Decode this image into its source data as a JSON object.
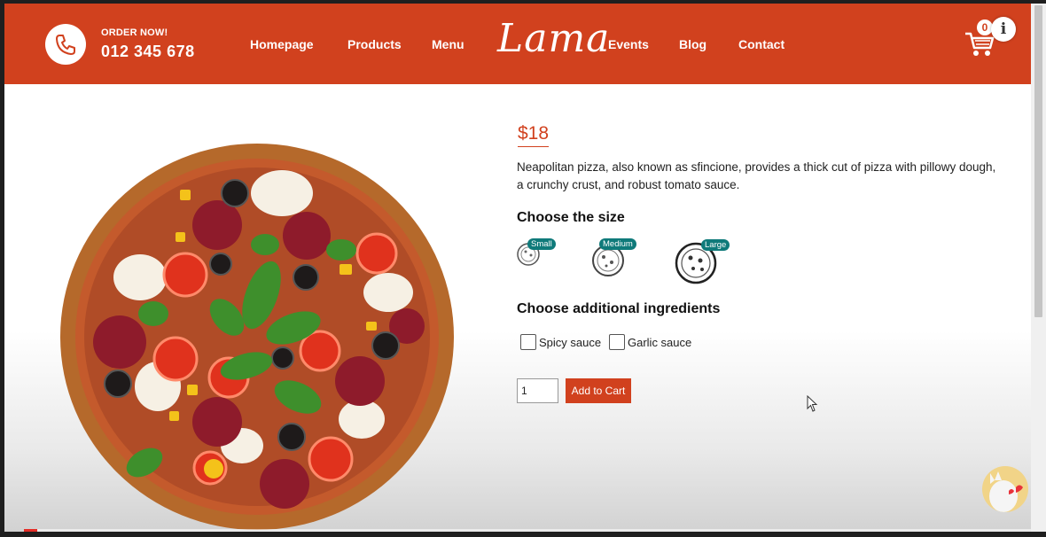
{
  "header": {
    "order_label": "ORDER NOW!",
    "phone": "012 345 678",
    "logo": "Lama",
    "nav_left": [
      "Homepage",
      "Products",
      "Menu"
    ],
    "nav_right": [
      "Events",
      "Blog",
      "Contact"
    ],
    "cart_count": "0",
    "info_icon": "info-icon"
  },
  "product": {
    "price": "$18",
    "description": "Neapolitan pizza, also known as sfincione, provides a thick cut of pizza with pillowy dough, a crunchy crust, and robust tomato sauce.",
    "size_heading": "Choose the size",
    "sizes": [
      "Small",
      "Medium",
      "Large"
    ],
    "ingredients_heading": "Choose additional ingredients",
    "ingredients": [
      "Spicy sauce",
      "Garlic sauce"
    ],
    "quantity": "1",
    "add_button": "Add to Cart"
  },
  "video": {
    "progress_fraction": 0.013
  },
  "colors": {
    "brand": "#d1411e",
    "badge": "#0f7a7a"
  }
}
